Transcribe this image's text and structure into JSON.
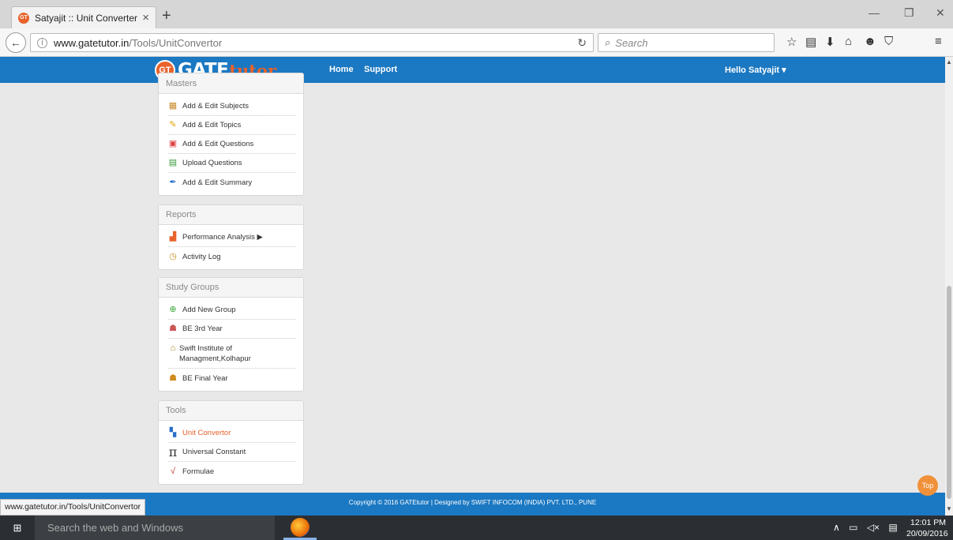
{
  "browser": {
    "tab_title": "Satyajit :: Unit Converter",
    "tab_favicon": "GT",
    "url_host": "www.gatetutor.in",
    "url_path": "/Tools/UnitConvertor",
    "search_placeholder": "Search",
    "status_url": "www.gatetutor.in/Tools/UnitConvertor"
  },
  "site": {
    "logo_badge": "GT",
    "logo_gate": "GATE",
    "logo_tutor": "tutor",
    "nav": {
      "home": "Home",
      "support": "Support"
    },
    "user_menu": "Hello Satyajit ▾",
    "footer": "Copyright © 2016 GATEtutor | Designed by SWIFT INFOCOM (INDIA) PVT. LTD., PUNE",
    "top_button": "Top"
  },
  "sidebar": {
    "masters": {
      "title": "Masters",
      "items": [
        {
          "label": "Add & Edit Subjects",
          "icon": "books-icon"
        },
        {
          "label": "Add & Edit Topics",
          "icon": "pencil-icon"
        },
        {
          "label": "Add & Edit Questions",
          "icon": "question-doc-icon"
        },
        {
          "label": "Upload Questions",
          "icon": "upload-doc-icon"
        },
        {
          "label": "Add & Edit Summary",
          "icon": "pen-icon"
        }
      ]
    },
    "reports": {
      "title": "Reports",
      "items": [
        {
          "label": "Performance Analysis ▶",
          "icon": "bar-chart-icon"
        },
        {
          "label": "Activity Log",
          "icon": "stopwatch-icon"
        }
      ]
    },
    "study_groups": {
      "title": "Study Groups",
      "items": [
        {
          "label": "Add New Group",
          "icon": "plus-circle-icon"
        },
        {
          "label": "BE 3rd Year",
          "icon": "group-icon"
        },
        {
          "label": "Swift Institute of Managment,Kolhapur",
          "icon": "institute-icon"
        },
        {
          "label": "BE Final Year",
          "icon": "group-icon"
        }
      ]
    },
    "tools": {
      "title": "Tools",
      "items": [
        {
          "label": "Unit Convertor",
          "icon": "converter-icon"
        },
        {
          "label": "Universal Constant",
          "icon": "pi-icon"
        },
        {
          "label": "Formulae",
          "icon": "formula-icon"
        }
      ]
    }
  },
  "taskbar": {
    "search_placeholder": "Search the web and Windows",
    "time": "12:01 PM",
    "date": "20/09/2016"
  }
}
